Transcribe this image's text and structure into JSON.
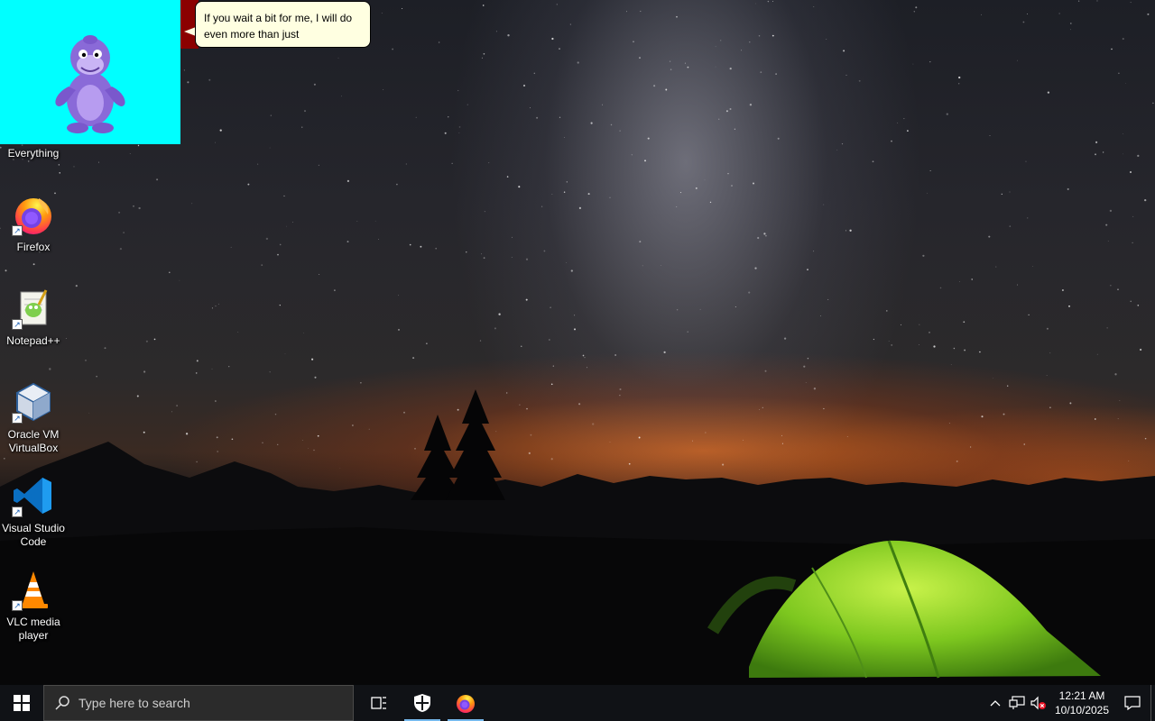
{
  "bonzi": {
    "speech_text": "If you wait a bit for me, I will do even more than just",
    "character_icon": "purple-gorilla",
    "panel_color": "#00ffff"
  },
  "desktop": {
    "icons": [
      {
        "label": "Everything",
        "icon": "everything-search-icon"
      },
      {
        "label": "Firefox",
        "icon": "firefox-icon"
      },
      {
        "label": "Notepad++",
        "icon": "notepad-plus-plus-icon"
      },
      {
        "label": "Oracle VM VirtualBox",
        "icon": "virtualbox-icon"
      },
      {
        "label": "Visual Studio Code",
        "icon": "vscode-icon"
      },
      {
        "label": "VLC media player",
        "icon": "vlc-icon"
      }
    ]
  },
  "taskbar": {
    "search_placeholder": "Type here to search",
    "pinned": [
      {
        "icon": "task-view-icon"
      },
      {
        "icon": "windows-security-icon",
        "active": true
      },
      {
        "icon": "firefox-icon",
        "active": true
      }
    ],
    "tray": {
      "time": "12:21 AM",
      "date": "10/10/2025",
      "icons": [
        "chevron-up-icon",
        "network-icon",
        "volume-muted-icon"
      ]
    },
    "accent_color": "#76b9ed"
  }
}
